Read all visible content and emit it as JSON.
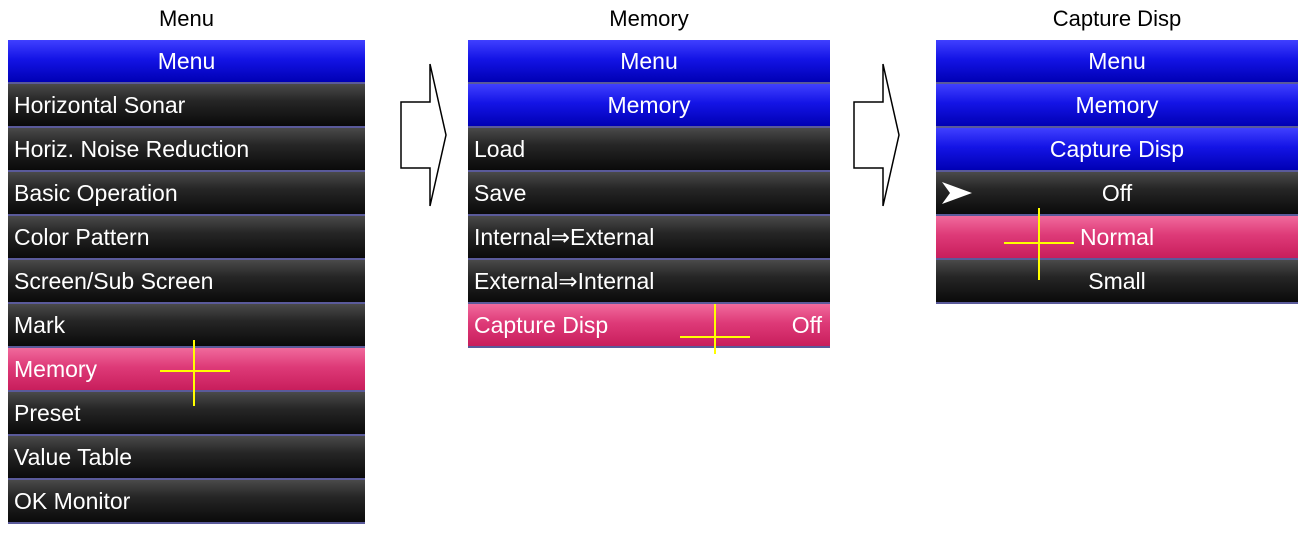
{
  "captions": {
    "menu": "Menu",
    "memory": "Memory",
    "capture": "Capture Disp"
  },
  "panel_menu": {
    "header": "Menu",
    "items": [
      "Horizontal Sonar",
      "Horiz. Noise Reduction",
      "Basic Operation",
      "Color Pattern",
      "Screen/Sub Screen",
      "Mark",
      "Memory",
      "Preset",
      "Value Table",
      "OK Monitor"
    ],
    "selected_index": 6
  },
  "panel_memory": {
    "headers": [
      "Menu",
      "Memory"
    ],
    "items": [
      {
        "label": "Load",
        "value": ""
      },
      {
        "label": "Save",
        "value": ""
      },
      {
        "label": "Internal⇒External",
        "value": ""
      },
      {
        "label": "External⇒Internal",
        "value": ""
      },
      {
        "label": "Capture Disp",
        "value": "Off"
      }
    ],
    "selected_index": 4
  },
  "panel_capture": {
    "headers": [
      "Menu",
      "Memory",
      "Capture Disp"
    ],
    "options": [
      "Off",
      "Normal",
      "Small"
    ],
    "current_index": 0,
    "selected_index": 1
  },
  "icons": {
    "pointer": "pointer-arrow-icon",
    "cursor": "crosshair-cursor-icon",
    "flow": "flow-arrow-icon"
  },
  "colors": {
    "header_blue": "#1414e6",
    "item_black": "#262626",
    "selected_pink": "#de3a78",
    "cursor_yellow": "#ffff00"
  }
}
